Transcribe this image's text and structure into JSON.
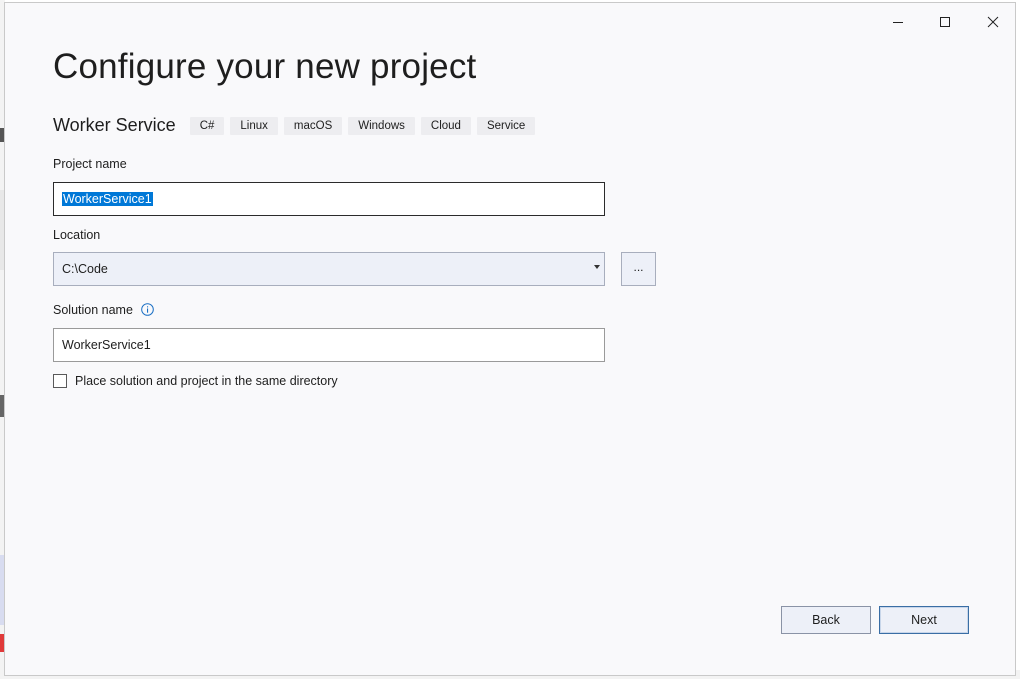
{
  "window": {
    "minimize_icon": "minimize-icon",
    "maximize_icon": "maximize-icon",
    "close_icon": "close-icon"
  },
  "page": {
    "title": "Configure your new project"
  },
  "template": {
    "name": "Worker Service",
    "tags": [
      "C#",
      "Linux",
      "macOS",
      "Windows",
      "Cloud",
      "Service"
    ]
  },
  "project_name": {
    "label": "Project name",
    "value": "WorkerService1",
    "selected": true
  },
  "location": {
    "label": "Location",
    "value": "C:\\Code",
    "browse_label": "..."
  },
  "solution_name": {
    "label": "Solution name",
    "value": "WorkerService1",
    "info_icon": "info-icon"
  },
  "same_directory": {
    "label": "Place solution and project in the same directory",
    "checked": false
  },
  "footer": {
    "back_label": "Back",
    "next_label": "Next"
  },
  "colors": {
    "selection": "#0078d7",
    "dialog_background": "#f9f9fb",
    "button_background": "#edf0f8",
    "info_icon": "#1a6fc4"
  }
}
